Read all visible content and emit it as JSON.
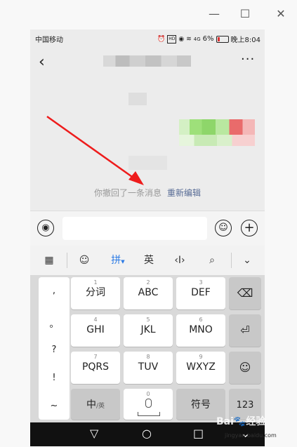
{
  "window": {
    "minimize": "—",
    "maximize": "☐",
    "close": "✕"
  },
  "status": {
    "carrier": "中国移动",
    "battery": "6%",
    "time": "晚上8:04",
    "signal": "4G"
  },
  "chat": {
    "more": "···",
    "recall_text": "你撤回了一条消息",
    "reedit": "重新编辑"
  },
  "toolbar": {
    "pinyin": "拼",
    "english": "英"
  },
  "keys": {
    "k1": {
      "num": "1",
      "label": "分词"
    },
    "k2": {
      "num": "2",
      "label": "ABC"
    },
    "k3": {
      "num": "3",
      "label": "DEF"
    },
    "k4": {
      "num": "4",
      "label": "GHI"
    },
    "k5": {
      "num": "5",
      "label": "JKL"
    },
    "k6": {
      "num": "6",
      "label": "MNO"
    },
    "k7": {
      "num": "7",
      "label": "PQRS"
    },
    "k8": {
      "num": "8",
      "label": "TUV"
    },
    "k9": {
      "num": "9",
      "label": "WXYZ"
    },
    "k0": {
      "num": "0"
    },
    "zh": "中",
    "en_small": "/英",
    "symbol": "符号",
    "num123": "123"
  },
  "punctuation": [
    ",",
    "。",
    "?",
    "!",
    "~"
  ],
  "watermark": {
    "brand": "Bai",
    "suffix": "经验",
    "url": "jingyan.baidu.com"
  }
}
